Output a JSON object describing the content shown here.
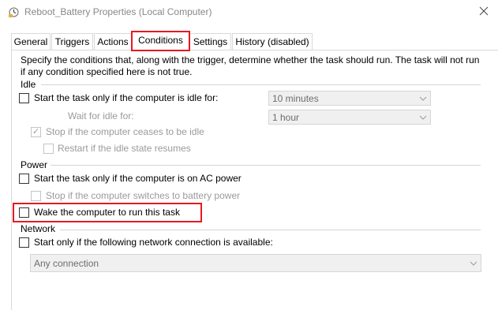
{
  "window": {
    "title": "Reboot_Battery Properties (Local Computer)",
    "icons": {
      "app": "clock-icon",
      "close": "close-icon"
    }
  },
  "tabs": [
    {
      "label": "General"
    },
    {
      "label": "Triggers"
    },
    {
      "label": "Actions"
    },
    {
      "label": "Conditions",
      "selected": true
    },
    {
      "label": "Settings"
    },
    {
      "label": "History (disabled)"
    }
  ],
  "conditions": {
    "description": "Specify the conditions that, along with the trigger, determine whether the task should run.  The task will not run  if any condition specified here is not true.",
    "idle": {
      "header": "Idle",
      "start_if_idle": {
        "label": "Start the task only if the computer is idle for:",
        "checked": false
      },
      "idle_duration": {
        "value": "10 minutes"
      },
      "wait_label": "Wait for idle for:",
      "wait_duration": {
        "value": "1 hour"
      },
      "stop_if_not_idle": {
        "label": "Stop if the computer ceases to be idle",
        "checked": true,
        "enabled": false
      },
      "restart_if_idle": {
        "label": "Restart if the idle state resumes",
        "checked": false,
        "enabled": false
      }
    },
    "power": {
      "header": "Power",
      "ac_power_only": {
        "label": "Start the task only if the computer is on AC power",
        "checked": false
      },
      "stop_on_battery": {
        "label": "Stop if the computer switches to battery power",
        "checked": false,
        "enabled": false
      },
      "wake_to_run": {
        "label": "Wake the computer to run this task",
        "checked": false
      }
    },
    "network": {
      "header": "Network",
      "require_network": {
        "label": "Start only if the following network connection is available:",
        "checked": false
      },
      "connection": {
        "value": "Any connection"
      }
    }
  },
  "colors": {
    "highlight": "#e8181f",
    "disabled_text": "#9a9a9a",
    "border": "#d9d9d9"
  }
}
